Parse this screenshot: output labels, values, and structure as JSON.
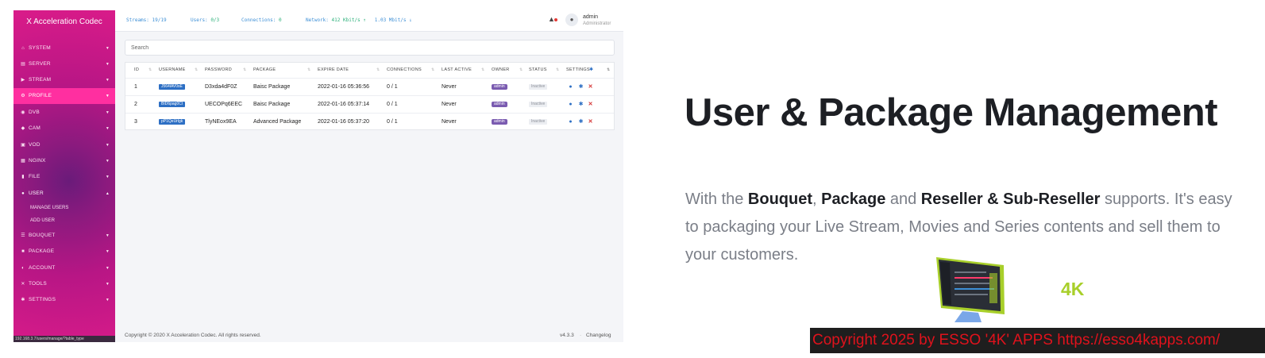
{
  "app": {
    "brand": "X Acceleration Codec",
    "status_url": "192.168.3.7/users/manage/?table_type",
    "topbar": {
      "streams_key": "Streams:",
      "streams_val": "19/19",
      "users_key": "Users:",
      "users_val": "0/3",
      "connections_key": "Connections:",
      "connections_val": "0",
      "network_key": "Network:",
      "network_up": "412 Kbit/s",
      "network_down": "1.03 Mbit/s",
      "user_name": "admin",
      "user_role": "Administrator"
    },
    "sidebar": {
      "items": [
        {
          "label": "SYSTEM",
          "icon": "home-icon"
        },
        {
          "label": "SERVER",
          "icon": "server-icon"
        },
        {
          "label": "STREAM",
          "icon": "stream-icon"
        },
        {
          "label": "PROFILE",
          "icon": "gears-icon"
        },
        {
          "label": "DVB",
          "icon": "satellite-icon"
        },
        {
          "label": "CAM",
          "icon": "cam-icon"
        },
        {
          "label": "VOD",
          "icon": "film-icon"
        },
        {
          "label": "NGINX",
          "icon": "code-icon"
        },
        {
          "label": "FILE",
          "icon": "file-icon"
        },
        {
          "label": "USER",
          "icon": "user-icon"
        },
        {
          "label": "BOUQUET",
          "icon": "list-icon"
        },
        {
          "label": "PACKAGE",
          "icon": "package-icon"
        },
        {
          "label": "ACCOUNT",
          "icon": "account-icon"
        },
        {
          "label": "TOOLS",
          "icon": "tools-icon"
        },
        {
          "label": "SETTINGS",
          "icon": "gear-icon"
        }
      ],
      "user_sub": [
        "MANAGE USERS",
        "ADD USER"
      ]
    },
    "search": {
      "placeholder": "Search"
    },
    "table": {
      "headers": [
        "ID",
        "USERNAME",
        "PASSWORD",
        "PACKAGE",
        "EXPIRE DATE",
        "CONNECTIONS",
        "LAST ACTIVE",
        "OWNER",
        "STATUS",
        "SETTINGS"
      ],
      "rows": [
        {
          "id": "1",
          "username": "J564lAV0sE",
          "password": "D3xda4dF0Z",
          "package": "Baisc Package",
          "expire": "2022-01-16 05:36:56",
          "connections": "0 / 1",
          "last_active": "Never",
          "owner": "admin",
          "status": "Inactive"
        },
        {
          "id": "2",
          "username": "BID6pag0Cl",
          "password": "UECOPq6EEC",
          "package": "Baisc Package",
          "expire": "2022-01-16 05:37:14",
          "connections": "0 / 1",
          "last_active": "Never",
          "owner": "admin",
          "status": "Inactive"
        },
        {
          "id": "3",
          "username": "pP1QeUrlgk",
          "password": "TlyNEox9EA",
          "package": "Advanced Package",
          "expire": "2022-01-16 05:37:20",
          "connections": "0 / 1",
          "last_active": "Never",
          "owner": "admin",
          "status": "Inactive"
        }
      ]
    },
    "footer": {
      "copyright": "Copyright © 2020 X Acceleration Codec. All rights reserved.",
      "version": "v4.3.3",
      "changelog": "Changelog"
    }
  },
  "marketing": {
    "headline": "User & Package Management",
    "desc_1": "With the ",
    "desc_b1": "Bouquet",
    "desc_2": ", ",
    "desc_b2": "Package",
    "desc_3": " and ",
    "desc_b3": "Reseller & Sub-Reseller",
    "desc_4": " supports. It's easy to packaging your Live Stream, Movies and Series contents and sell them to your customers.",
    "label_4k": "4K",
    "copyright": "Copyright 2025  by ESSO '4K' APPS https://esso4kapps.com/"
  },
  "colors": {
    "sidebar": "#e01a8b",
    "active_item": "#ff2fa0",
    "accent_green": "#a8cf2a",
    "copyright_red": "#e0121c"
  }
}
